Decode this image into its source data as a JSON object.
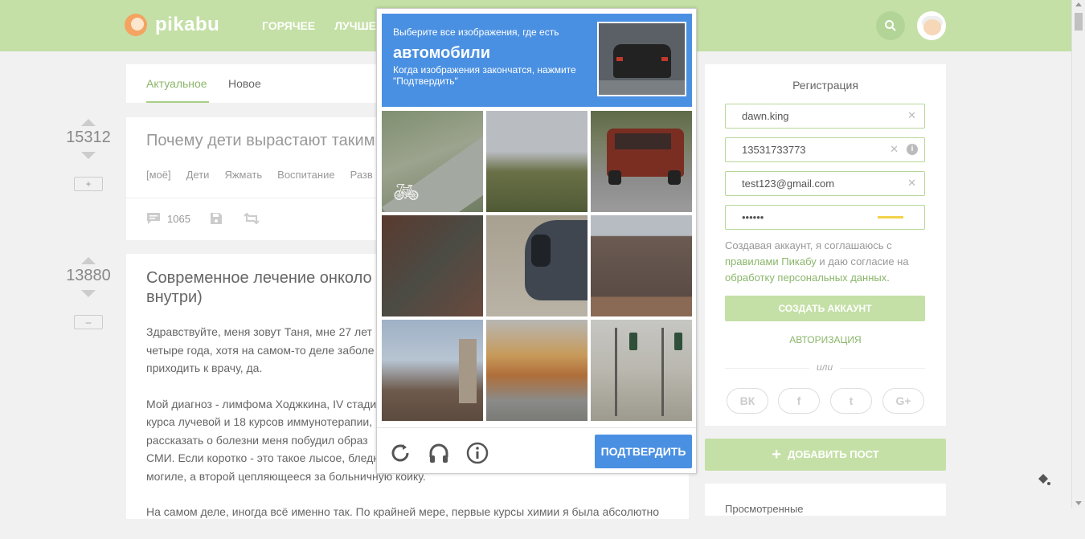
{
  "header": {
    "logo": "pikabu",
    "nav": [
      "ГОРЯЧЕЕ",
      "ЛУЧШЕЕ"
    ]
  },
  "feed_tabs": [
    "Актуальное",
    "Новое"
  ],
  "story1": {
    "rating": "15312",
    "plus": "+",
    "title": "Почему дети вырастают такими",
    "tags": [
      "[моё]",
      "Дети",
      "Яжмать",
      "Воспитание",
      "Разв"
    ],
    "comments": "1065"
  },
  "story2": {
    "rating": "13880",
    "minus": "–",
    "title": "Современное лечение онколо                                                                      внутри)",
    "title_l1": "Современное лечение онколо",
    "title_l2": "внутри)",
    "p1_lines": [
      "Здравствуйте, меня зовут Таня, мне 27 лет",
      "четыре года, хотя на самом-то деле заболе",
      "приходить к врачу, да."
    ],
    "p2_lines": [
      "Мой диагноз - лимфома Ходжкина, IV стади",
      "курса лучевой и 18 курсов иммунотерапии,",
      "рассказать о болезни меня побудил образ",
      "СМИ. Если коротко - это такое лысое, бледн",
      "могиле, а второй цепляющееся за больничную койку."
    ],
    "p3_line": "На самом деле, иногда всё именно так. По крайней мере, первые курсы химии я была абсолютно"
  },
  "registration": {
    "title": "Регистрация",
    "login_value": "dawn.king",
    "phone_value": "13531733773",
    "email_value": "test123@gmail.com",
    "password_value": "••••••",
    "agree_text_1": "Создавая аккаунт, я соглашаюсь с",
    "agree_link_1": "правилами Пикабу",
    "agree_text_2": " и даю согласие на",
    "agree_link_2": "обработку персональных данных",
    "agree_text_3": ".",
    "create_label": "СОЗДАТЬ АККАУНТ",
    "login_label": "АВТОРИЗАЦИЯ",
    "or_label": "или",
    "social": [
      "ВК",
      "f",
      "t",
      "G+"
    ]
  },
  "add_post_label": "ДОБАВИТЬ ПОСТ",
  "viewed_label": "Просмотренные",
  "captcha": {
    "line1": "Выберите все изображения, где есть",
    "target": "автомобили",
    "line3": "Когда изображения закончатся, нажмите \"Подтвердить\"",
    "verify_label": "ПОДТВЕРДИТЬ",
    "tiles": [
      "bike-lane",
      "trees",
      "red-suv",
      "brick-wall",
      "dark-car",
      "roof",
      "chimney",
      "autumn-street",
      "traffic-lights"
    ]
  },
  "colors": {
    "header": "#c4e0a6",
    "accent": "#8ab66a",
    "captcha_blue": "#4a90e2"
  }
}
